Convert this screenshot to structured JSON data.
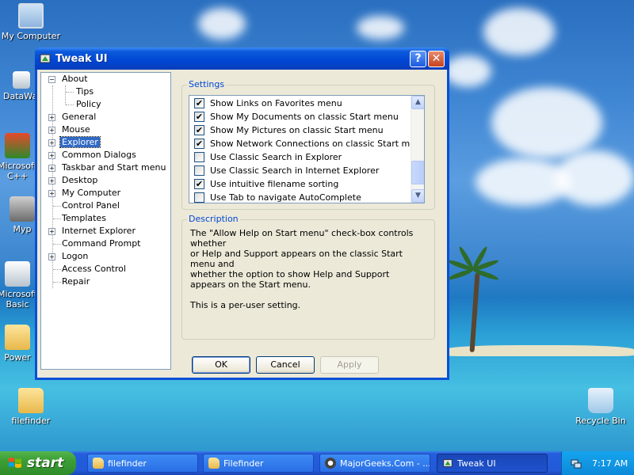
{
  "desktop": {
    "icons": [
      {
        "label": "My Computer",
        "icon": "my-computer-icon"
      },
      {
        "label": "DataWa",
        "icon": "shortcut-icon"
      },
      {
        "label": "Microsoft C++",
        "icon": "app-shortcut-icon"
      },
      {
        "label": "Myp",
        "icon": "app-shortcut-icon"
      },
      {
        "label": "Microsoft Basic",
        "icon": "app-shortcut-icon"
      },
      {
        "label": "Power",
        "icon": "folder-icon"
      },
      {
        "label": "filefinder",
        "icon": "folder-icon"
      },
      {
        "label": "Recycle Bin",
        "icon": "recycle-bin-icon"
      }
    ]
  },
  "window": {
    "title": "Tweak UI",
    "help_button": "?",
    "close_button": "✕"
  },
  "tree": {
    "items": [
      {
        "label": "About",
        "expander": "−"
      },
      {
        "label": "Tips",
        "expander": ""
      },
      {
        "label": "Policy",
        "expander": ""
      },
      {
        "label": "General",
        "expander": "+"
      },
      {
        "label": "Mouse",
        "expander": "+"
      },
      {
        "label": "Explorer",
        "expander": "+"
      },
      {
        "label": "Common Dialogs",
        "expander": "+"
      },
      {
        "label": "Taskbar and Start menu",
        "expander": "+"
      },
      {
        "label": "Desktop",
        "expander": "+"
      },
      {
        "label": "My Computer",
        "expander": "+"
      },
      {
        "label": "Control Panel",
        "expander": ""
      },
      {
        "label": "Templates",
        "expander": ""
      },
      {
        "label": "Internet Explorer",
        "expander": "+"
      },
      {
        "label": "Command Prompt",
        "expander": ""
      },
      {
        "label": "Logon",
        "expander": "+"
      },
      {
        "label": "Access Control",
        "expander": ""
      },
      {
        "label": "Repair",
        "expander": ""
      }
    ],
    "selected": "Explorer"
  },
  "settings": {
    "title": "Settings",
    "items": [
      {
        "label": "Show Links on Favorites menu",
        "checked": true
      },
      {
        "label": "Show My Documents on classic Start menu",
        "checked": true
      },
      {
        "label": "Show My Pictures on classic Start menu",
        "checked": true
      },
      {
        "label": "Show Network Connections on classic Start menu",
        "checked": true
      },
      {
        "label": "Use Classic Search in Explorer",
        "checked": false
      },
      {
        "label": "Use Classic Search in Internet Explorer",
        "checked": false
      },
      {
        "label": "Use intuitive filename sorting",
        "checked": true
      },
      {
        "label": "Use Tab to navigate AutoComplete",
        "checked": false
      }
    ],
    "check_mark": "✔"
  },
  "description": {
    "title": "Description",
    "lines": [
      "The \"Allow Help on Start menu\" check-box controls whether",
      "or Help and Support appears on the classic Start menu and",
      "whether the option to show Help and Support",
      "appears on the Start menu."
    ],
    "note": "This is a per-user setting."
  },
  "buttons": {
    "ok": "OK",
    "cancel": "Cancel",
    "apply": "Apply"
  },
  "taskbar": {
    "start_label": "start",
    "tasks": [
      {
        "label": "filefinder",
        "icon": "folder-icon",
        "active": false
      },
      {
        "label": "Filefinder",
        "icon": "folder-icon",
        "active": false
      },
      {
        "label": "MajorGeeks.Com - ...",
        "icon": "browser-icon",
        "active": false
      },
      {
        "label": "Tweak UI",
        "icon": "tweakui-icon",
        "active": true
      }
    ],
    "clock": "7:17 AM"
  },
  "colors": {
    "selection": "#316ac5",
    "titlebar": "#0046d4",
    "group_title": "#0046d5"
  }
}
